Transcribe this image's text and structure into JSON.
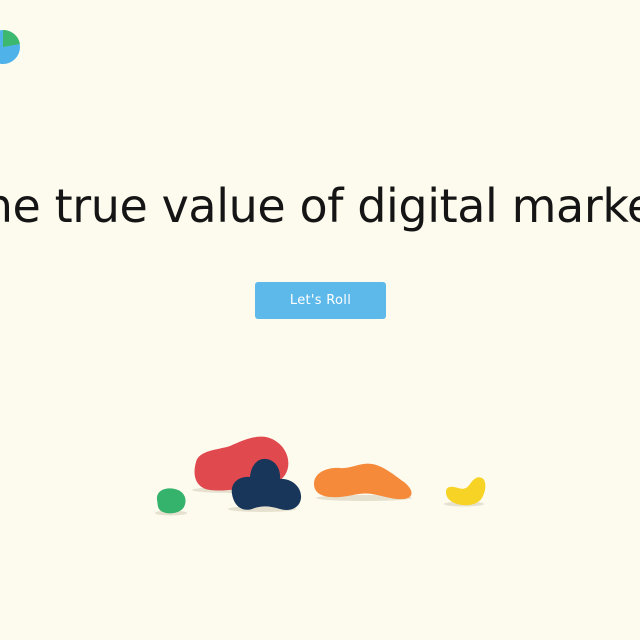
{
  "hero": {
    "headline": "The true value of digital marketing",
    "cta_label": "Let's Roll"
  },
  "colors": {
    "background": "#fdfaee",
    "cta": "#5db9ea",
    "logo_blue": "#4fb3ea",
    "logo_green": "#3db86f",
    "blob_red": "#e04a4f",
    "blob_navy": "#17365a",
    "blob_orange": "#f58a3a",
    "blob_green": "#35b26b",
    "blob_yellow": "#f7d326"
  },
  "icons": {
    "logo": "brand-logo-icon"
  }
}
